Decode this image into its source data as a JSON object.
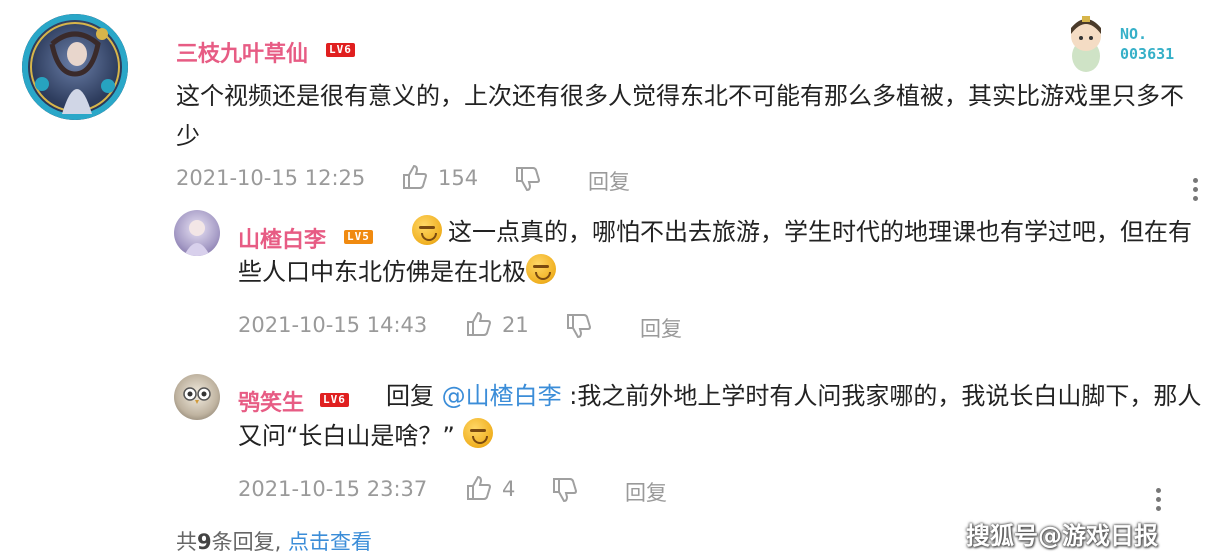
{
  "badge": {
    "line1": "NO.",
    "line2": "003631"
  },
  "comments": [
    {
      "username": "三枝九叶草仙",
      "level": "LV6",
      "text": "这个视频还是很有意义的，上次还有很多人觉得东北不可能有那么多植被，其实比游戏里只多不少",
      "timestamp": "2021-10-15 12:25",
      "likes": "154",
      "reply_label": "回复"
    }
  ],
  "replies": [
    {
      "username": "山楂白李",
      "level": "LV5",
      "text_part1": "这一点真的，哪怕不出去旅游，学生时代的地理课也有学过吧，但在有些人口中东北仿佛是在北极",
      "timestamp": "2021-10-15 14:43",
      "likes": "21",
      "reply_label": "回复"
    },
    {
      "username": "鸮笑生",
      "level": "LV6",
      "reply_prefix": "回复",
      "mention": "@山楂白李",
      "text_part1": ":我之前外地上学时有人问我家哪的，我说长白山脚下，那人又问“长白山是啥？”",
      "timestamp": "2021-10-15 23:37",
      "likes": "4",
      "reply_label": "回复"
    }
  ],
  "footer": {
    "total_prefix": "共",
    "total_count": "9",
    "total_suffix": "条回复,",
    "view_link": "点击查看"
  },
  "watermark": "搜狐号@游戏日报",
  "colors": {
    "username": "#e75c84",
    "meta_gray": "#9a9a9a",
    "link_blue": "#3b8dd8",
    "level_red": "#e01f1f",
    "level_orange": "#f08a10"
  }
}
